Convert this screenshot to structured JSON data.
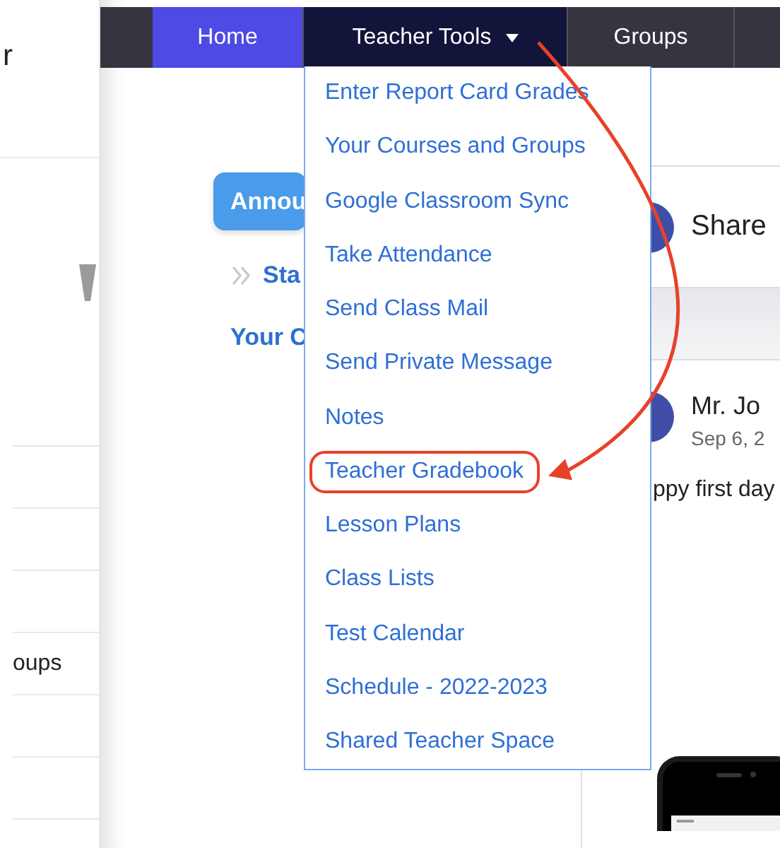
{
  "background_window": {
    "texts": [
      "r",
      "oups"
    ]
  },
  "nav": {
    "tabs": [
      {
        "label": "Home",
        "selected": true,
        "expanded": false
      },
      {
        "label": "Teacher Tools",
        "selected": false,
        "expanded": true
      },
      {
        "label": "Groups",
        "selected": false,
        "expanded": false
      }
    ]
  },
  "sidebar": {
    "button": "Annou",
    "links": [
      {
        "text": "Sta",
        "kind": "chevron"
      },
      {
        "text": "Your C",
        "kind": "plain"
      }
    ]
  },
  "feed": {
    "share_card": {
      "text": "Share"
    },
    "post": {
      "author": "Mr. Jo",
      "date": "Sep 6, 2",
      "body": "ppy first day"
    }
  },
  "menu": {
    "items": [
      {
        "label": "Enter Report Card Grades",
        "highlighted": false
      },
      {
        "label": "Your Courses and Groups",
        "highlighted": false
      },
      {
        "label": "Google Classroom Sync",
        "highlighted": false
      },
      {
        "label": "Take Attendance",
        "highlighted": false
      },
      {
        "label": "Send Class Mail",
        "highlighted": false
      },
      {
        "label": "Send Private Message",
        "highlighted": false
      },
      {
        "label": "Notes",
        "highlighted": false
      },
      {
        "label": "Teacher Gradebook",
        "highlighted": true
      },
      {
        "label": "Lesson Plans",
        "highlighted": false
      },
      {
        "label": "Class Lists",
        "highlighted": false
      },
      {
        "label": "Test Calendar",
        "highlighted": false
      },
      {
        "label": "Schedule - 2022-2023",
        "highlighted": false
      },
      {
        "label": "Shared Teacher Space",
        "highlighted": false
      }
    ]
  }
}
